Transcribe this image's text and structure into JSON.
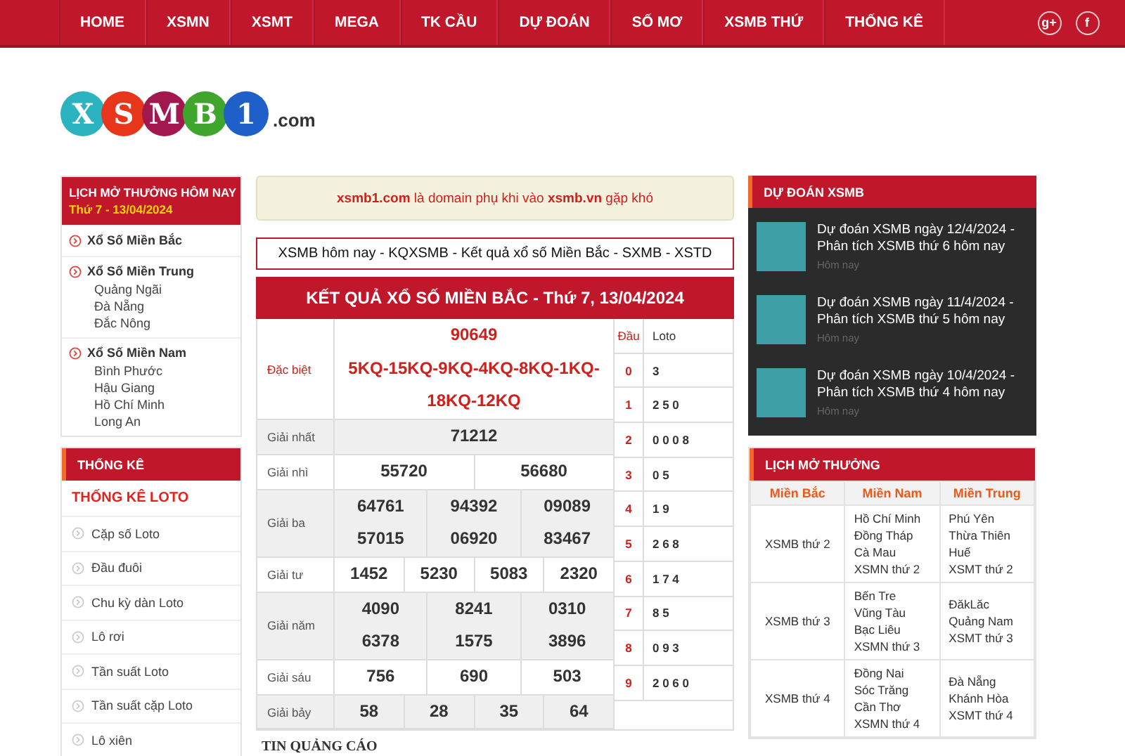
{
  "nav": {
    "items": [
      "HOME",
      "XSMN",
      "XSMT",
      "MEGA",
      "TK CẦU",
      "DỰ ĐOÁN",
      "SỐ MƠ",
      "XSMB THỨ",
      "THỐNG KÊ"
    ],
    "social": [
      "g+",
      "f"
    ]
  },
  "logo": {
    "balls": [
      {
        "letter": "X",
        "color": "#2bb3c0"
      },
      {
        "letter": "S",
        "color": "#e8361c"
      },
      {
        "letter": "M",
        "color": "#a3174f"
      },
      {
        "letter": "B",
        "color": "#3fa52c"
      },
      {
        "letter": "1",
        "color": "#1f5fc8"
      }
    ],
    "suffix": ".com"
  },
  "schedule_today": {
    "title": "LỊCH MỞ THƯỞNG HÔM NAY",
    "date": "Thứ 7 - 13/04/2024",
    "regions": [
      {
        "name": "Xổ Số Miền Bắc"
      },
      {
        "name": "Xổ Số Miền Trung",
        "provinces": [
          "Quảng Ngãi",
          "Đà Nẵng",
          "Đắc Nông"
        ]
      },
      {
        "name": "Xổ Số Miền Nam",
        "provinces": [
          "Bình Phước",
          "Hậu Giang",
          "Hồ Chí Minh",
          "Long An"
        ]
      }
    ]
  },
  "stats": {
    "title": "THỐNG KÊ",
    "heading": "THỐNG KÊ LOTO",
    "items": [
      "Cặp số Loto",
      "Đầu đuôi",
      "Chu kỳ dàn Loto",
      "Lô rơi",
      "Tần suất Loto",
      "Tần suất cặp Loto",
      "Lô xiên"
    ]
  },
  "notice": "**xsmb1.com** là domain phụ khi vào **xsmb.vn** gặp khó",
  "heading_link": "XSMB hôm nay - KQXSMB - Kết quả xổ số Miền Bắc - SXMB - XSTD",
  "results": {
    "title": "KẾT QUẢ XỔ SỐ MIỀN BẮC - Thứ 7, 13/04/2024",
    "prizes": [
      {
        "label": "Đặc biệt",
        "kind": "special",
        "lines": [
          [
            "90649"
          ],
          [
            "5KQ-15KQ-9KQ-4KQ-8KQ-1KQ-18KQ-12KQ"
          ]
        ]
      },
      {
        "label": "Giải nhất",
        "kind": "normal",
        "lines": [
          [
            "71212"
          ]
        ]
      },
      {
        "label": "Giải nhì",
        "kind": "normal",
        "lines": [
          [
            "55720",
            "56680"
          ]
        ]
      },
      {
        "label": "Giải ba",
        "kind": "normal",
        "lines": [
          [
            "64761",
            "94392",
            "09089"
          ],
          [
            "57015",
            "06920",
            "83467"
          ]
        ]
      },
      {
        "label": "Giải tư",
        "kind": "normal",
        "lines": [
          [
            "1452",
            "5230",
            "5083",
            "2320"
          ]
        ]
      },
      {
        "label": "Giải năm",
        "kind": "normal",
        "lines": [
          [
            "4090",
            "8241",
            "0310"
          ],
          [
            "6378",
            "1575",
            "3896"
          ]
        ]
      },
      {
        "label": "Giải sáu",
        "kind": "normal",
        "lines": [
          [
            "756",
            "690",
            "503"
          ]
        ]
      },
      {
        "label": "Giải bảy",
        "kind": "normal",
        "lines": [
          [
            "58",
            "28",
            "35",
            "64"
          ]
        ]
      }
    ],
    "loto_columns": [
      "Đầu",
      "Loto"
    ],
    "loto": [
      {
        "head": "0",
        "tails": "3"
      },
      {
        "head": "1",
        "tails": "2 5 0"
      },
      {
        "head": "2",
        "tails": "0 0 0 8"
      },
      {
        "head": "3",
        "tails": "0 5"
      },
      {
        "head": "4",
        "tails": "1 9"
      },
      {
        "head": "5",
        "tails": "2 6 8"
      },
      {
        "head": "6",
        "tails": "1 7 4"
      },
      {
        "head": "7",
        "tails": "8 5"
      },
      {
        "head": "8",
        "tails": "0 9 3"
      },
      {
        "head": "9",
        "tails": "2 0 6 0"
      }
    ]
  },
  "ads": {
    "title": "TIN QUẢNG CÁO"
  },
  "predictions": {
    "title": "DỰ ĐOÁN XSMB",
    "items": [
      {
        "title": "Dự đoán XSMB ngày 12/4/2024 - Phân tích XSMB thứ 6 hôm nay",
        "time": "Hôm nay"
      },
      {
        "title": "Dự đoán XSMB ngày 11/4/2024 - Phân tích XSMB thứ 5 hôm nay",
        "time": "Hôm nay"
      },
      {
        "title": "Dự đoán XSMB ngày 10/4/2024 - Phân tích XSMB thứ 4 hôm nay",
        "time": "Hôm nay"
      }
    ]
  },
  "schedule": {
    "title": "LỊCH MỞ THƯỞNG",
    "columns": [
      "Miền Bắc",
      "Miền Nam",
      "Miền Trung"
    ],
    "rows": [
      [
        [
          "XSMB thứ 2"
        ],
        [
          "Hồ Chí Minh",
          "Đồng Tháp",
          "Cà Mau",
          "XSMN thứ 2"
        ],
        [
          "Phú Yên",
          "Thừa Thiên",
          "Huế",
          "XSMT thứ 2"
        ]
      ],
      [
        [
          "XSMB thứ 3"
        ],
        [
          "Bến Tre",
          "Vũng Tàu",
          "Bạc Liêu",
          "XSMN thứ 3"
        ],
        [
          "ĐăkLăc",
          "Quảng Nam",
          "XSMT thứ 3"
        ]
      ],
      [
        [
          "XSMB thứ 4"
        ],
        [
          "Đồng Nai",
          "Sóc Trăng",
          "Cần Thơ",
          "XSMN thứ 4"
        ],
        [
          "Đà Nẵng",
          "Khánh Hòa",
          "XSMT thứ 4"
        ]
      ]
    ]
  }
}
